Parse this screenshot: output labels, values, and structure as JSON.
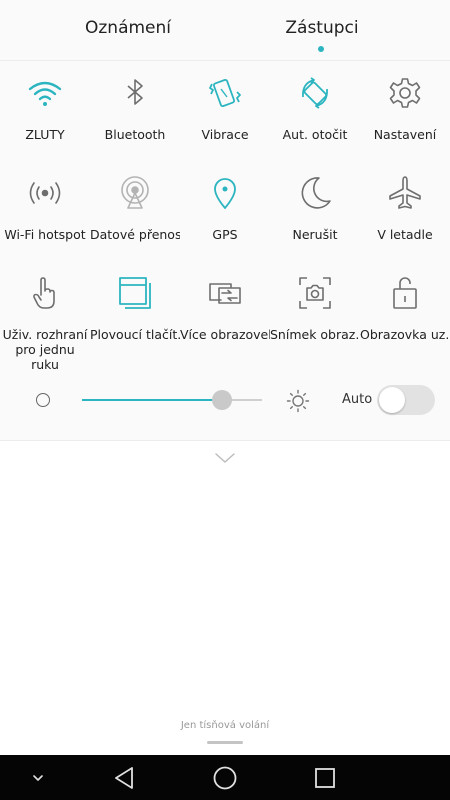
{
  "tabs": [
    {
      "label": "Oznámení",
      "active": false
    },
    {
      "label": "Zástupci",
      "active": true
    }
  ],
  "colors": {
    "accent": "#2cb5c0",
    "icon_gray": "#6e6e6e"
  },
  "tiles": [
    {
      "label": "ZLUTY",
      "icon": "wifi-icon",
      "active": true
    },
    {
      "label": "Bluetooth",
      "icon": "bluetooth-icon",
      "active": false
    },
    {
      "label": "Vibrace",
      "icon": "vibrate-icon",
      "active": true
    },
    {
      "label": "Aut. otočit",
      "icon": "auto-rotate-icon",
      "active": true
    },
    {
      "label": "Nastavení",
      "icon": "gear-icon",
      "active": false
    },
    {
      "label": "Wi-Fi hotspot",
      "icon": "hotspot-icon",
      "active": false
    },
    {
      "label": "Datové přenosy",
      "icon": "mobile-data-icon",
      "active": false
    },
    {
      "label": "GPS",
      "icon": "location-pin-icon",
      "active": true
    },
    {
      "label": "Nerušit",
      "icon": "moon-icon",
      "active": false
    },
    {
      "label": "V letadle",
      "icon": "airplane-icon",
      "active": false
    },
    {
      "label": "Uživ. rozhraní pro jednu ruku",
      "icon": "one-hand-icon",
      "active": false
    },
    {
      "label": "Plovoucí tlačít...",
      "icon": "floating-button-icon",
      "active": true
    },
    {
      "label": "Více obrazovek",
      "icon": "multi-screen-icon",
      "active": false
    },
    {
      "label": "Snímek obraz...",
      "icon": "screenshot-icon",
      "active": false
    },
    {
      "label": "Obrazovka uz...",
      "icon": "unlock-icon",
      "active": false
    }
  ],
  "brightness": {
    "level_fraction": 0.78,
    "auto_label": "Auto",
    "auto_enabled": false
  },
  "emergency_text": "Jen tísňová volání",
  "nav": {
    "icons": [
      "chevron-down-icon",
      "back-icon",
      "home-icon",
      "recents-icon"
    ]
  }
}
